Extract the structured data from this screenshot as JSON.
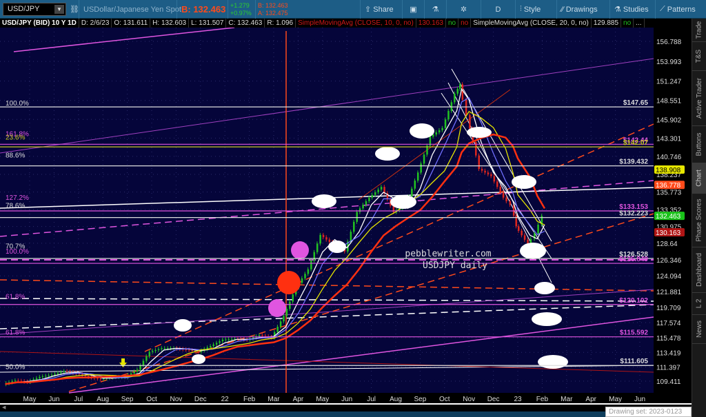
{
  "toolbar": {
    "symbol": "USD/JPY",
    "description": "USDollar/Japanese Yen Spot",
    "bid_big": "B: 132.463",
    "change": "+1.279",
    "change_pct": "+0.97%",
    "bid": "B: 132.463",
    "ask": "A: 132.475",
    "share": "Share",
    "interval": "D",
    "style": "Style",
    "drawings": "Drawings",
    "studies": "Studies",
    "patterns": "Patterns"
  },
  "infobar": {
    "title": "USD/JPY (BID) 10 Y 1D",
    "date": "D: 2/6/23",
    "open": "O: 131.611",
    "high": "H: 132.603",
    "low": "L: 131.507",
    "close": "C: 132.463",
    "range": "R: 1.096",
    "sma10": "SimpleMovingAvg (CLOSE, 10, 0, no)",
    "sma10_val": "130.163",
    "no1": "no",
    "no2": "no",
    "sma20": "SimpleMovingAvg (CLOSE, 20, 0, no)",
    "sma20_val": "129.885",
    "no3": "no",
    "more": "..."
  },
  "colors": {
    "up": "#22c322",
    "down": "#e0261e",
    "bg": "#05053a",
    "magenta": "#e055e0",
    "orange": "#ff4a1a",
    "yellow": "#e6e600"
  },
  "chart_data": {
    "type": "candlestick",
    "title": "USD/JPY (BID) 10 Y 1D",
    "x_labels": [
      "May",
      "Jun",
      "Jul",
      "Aug",
      "Sep",
      "Oct",
      "Nov",
      "Dec",
      "22",
      "Feb",
      "Mar",
      "Apr",
      "May",
      "Jun",
      "Jul",
      "Aug",
      "Sep",
      "Oct",
      "Nov",
      "Dec",
      "23",
      "Feb",
      "Mar",
      "Apr",
      "May",
      "Jun"
    ],
    "y_ticks": [
      "156.788",
      "153.993",
      "151.247",
      "148.551",
      "145.902",
      "143.301",
      "140.746",
      "138.237",
      "135.773",
      "133.352",
      "130.975",
      "128.64",
      "126.346",
      "124.094",
      "121.881",
      "119.709",
      "117.574",
      "115.478",
      "113.419",
      "111.397",
      "109.411"
    ],
    "ylim": [
      108.0,
      158.5
    ],
    "close_series": [
      [
        -1.0,
        109.0
      ],
      [
        -0.5,
        109.5
      ],
      [
        0,
        109.3
      ],
      [
        0.5,
        110
      ],
      [
        1,
        110.3
      ],
      [
        1.5,
        110.8
      ],
      [
        2,
        110.5
      ],
      [
        2.5,
        110
      ],
      [
        3,
        109.7
      ],
      [
        3.5,
        110
      ],
      [
        4,
        110
      ],
      [
        4.5,
        111
      ],
      [
        5,
        113.5
      ],
      [
        5.5,
        114
      ],
      [
        6,
        114
      ],
      [
        6.5,
        113.8
      ],
      [
        7,
        113.5
      ],
      [
        7.5,
        114.3
      ],
      [
        8,
        115.2
      ],
      [
        8.5,
        115.3
      ],
      [
        9,
        115.2
      ],
      [
        9.5,
        115.8
      ],
      [
        10,
        115.5
      ],
      [
        10.5,
        118.5
      ],
      [
        11,
        122.5
      ],
      [
        11.5,
        125
      ],
      [
        12,
        129.8
      ],
      [
        12.5,
        128.5
      ],
      [
        13,
        127.5
      ],
      [
        13.5,
        133
      ],
      [
        14,
        135
      ],
      [
        14.5,
        136.5
      ],
      [
        15,
        133
      ],
      [
        15.5,
        134
      ],
      [
        16,
        138.5
      ],
      [
        16.5,
        143.5
      ],
      [
        17,
        144.7
      ],
      [
        17.5,
        149.5
      ],
      [
        17.7,
        150.8
      ],
      [
        18,
        146.5
      ],
      [
        18.5,
        139
      ],
      [
        19,
        138
      ],
      [
        19.5,
        135
      ],
      [
        19.8,
        134
      ],
      [
        20,
        131
      ],
      [
        20.5,
        128.5
      ],
      [
        20.8,
        130
      ],
      [
        21.1,
        132.46
      ]
    ],
    "levels": [
      {
        "label": "$147.65",
        "price": 147.65,
        "color": "#ddd"
      },
      {
        "label": "$142.44",
        "price": 142.44,
        "color": "#e055e0"
      },
      {
        "label": "$142.07",
        "price": 142.07,
        "color": "#c8c820"
      },
      {
        "label": "$139.432",
        "price": 139.43,
        "color": "#ddd"
      },
      {
        "label": "$133.153",
        "price": 133.15,
        "color": "#e055e0"
      },
      {
        "label": "$132.223",
        "price": 132.22,
        "color": "#ddd"
      },
      {
        "label": "$126.528",
        "price": 126.52,
        "color": "#ddd"
      },
      {
        "label": "$125.849",
        "price": 125.84,
        "color": "#e055e0"
      },
      {
        "label": "$120.102",
        "price": 120.1,
        "color": "#e055e0"
      },
      {
        "label": "$115.592",
        "price": 115.59,
        "color": "#e055e0"
      },
      {
        "label": "$111.605",
        "price": 111.6,
        "color": "#ddd"
      }
    ],
    "fib_labels": [
      {
        "label": "100.0%",
        "price": 147.65,
        "color": "#ddd"
      },
      {
        "label": "161.8%",
        "price": 143.4,
        "color": "#e055e0"
      },
      {
        "label": "23.6%",
        "price": 142.9,
        "color": "#c8c820"
      },
      {
        "label": "88.6%",
        "price": 140.4,
        "color": "#ddd"
      },
      {
        "label": "127.2%",
        "price": 134.5,
        "color": "#e055e0"
      },
      {
        "label": "78.6%",
        "price": 133.4,
        "color": "#ddd"
      },
      {
        "label": "70.7%",
        "price": 127.7,
        "color": "#ddd"
      },
      {
        "label": "100.0%",
        "price": 127.0,
        "color": "#e055e0"
      },
      {
        "label": "61.8%",
        "price": 120.7,
        "color": "#e055e0"
      },
      {
        "label": "61.8%",
        "price": 115.7,
        "color": "#e055e0"
      },
      {
        "label": "50.0%",
        "price": 110.9,
        "color": "#ddd"
      }
    ],
    "badges": [
      {
        "label": "138.908",
        "price": 138.908,
        "bg": "#e6e600",
        "fg": "#000"
      },
      {
        "label": "136.778",
        "price": 136.778,
        "bg": "#ff4a1a",
        "fg": "#fff"
      },
      {
        "label": "132.463",
        "price": 132.463,
        "bg": "#19c219",
        "fg": "#fff"
      },
      {
        "label": "130.163",
        "price": 130.163,
        "bg": "#b01515",
        "fg": "#fff"
      }
    ],
    "annotations": [
      "pebblewriter.com",
      "USDJPY daily"
    ]
  },
  "sidetabs": [
    "Trade",
    "T&S",
    "Active Trader",
    "Buttons",
    "Chart",
    "Phase Scores",
    "Dashboard",
    "L 2",
    "News"
  ],
  "drawing_set": "Drawing set: 2023-0123"
}
